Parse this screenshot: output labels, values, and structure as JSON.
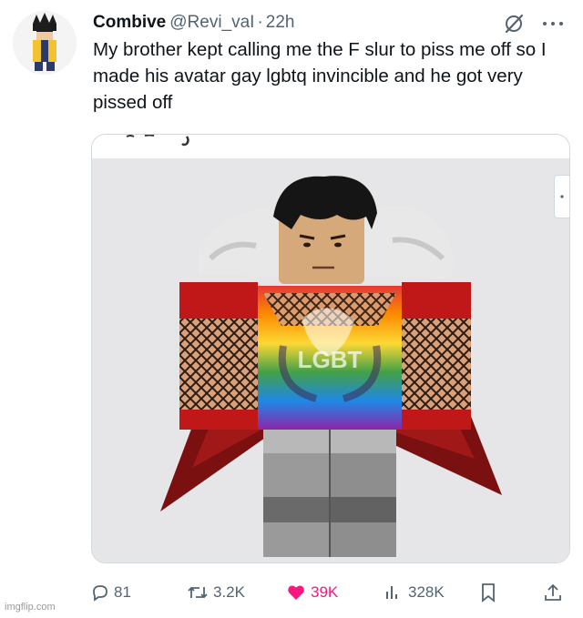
{
  "author": {
    "display_name": "Combive",
    "handle": "@Revi_vaI",
    "separator": "·",
    "time": "22h"
  },
  "tweet": {
    "text": "My brother kept calling me the F slur to piss me off so I made his avatar gay lgbtq invincible and he got very pissed off"
  },
  "media": {
    "shirt_text": "LGBT"
  },
  "actions": {
    "replies": "81",
    "retweets": "3.2K",
    "likes": "39K",
    "views": "328K"
  },
  "watermark": "imgflip.com",
  "colors": {
    "like": "#f91880",
    "secondary_text": "#536471",
    "border": "#cfd9de"
  },
  "icons": {
    "reply": "reply-icon",
    "retweet": "retweet-icon",
    "like": "heart-filled-icon",
    "views": "views-icon",
    "bookmark": "bookmark-icon",
    "share": "share-icon",
    "grok": "grok-icon",
    "more": "more-icon"
  }
}
